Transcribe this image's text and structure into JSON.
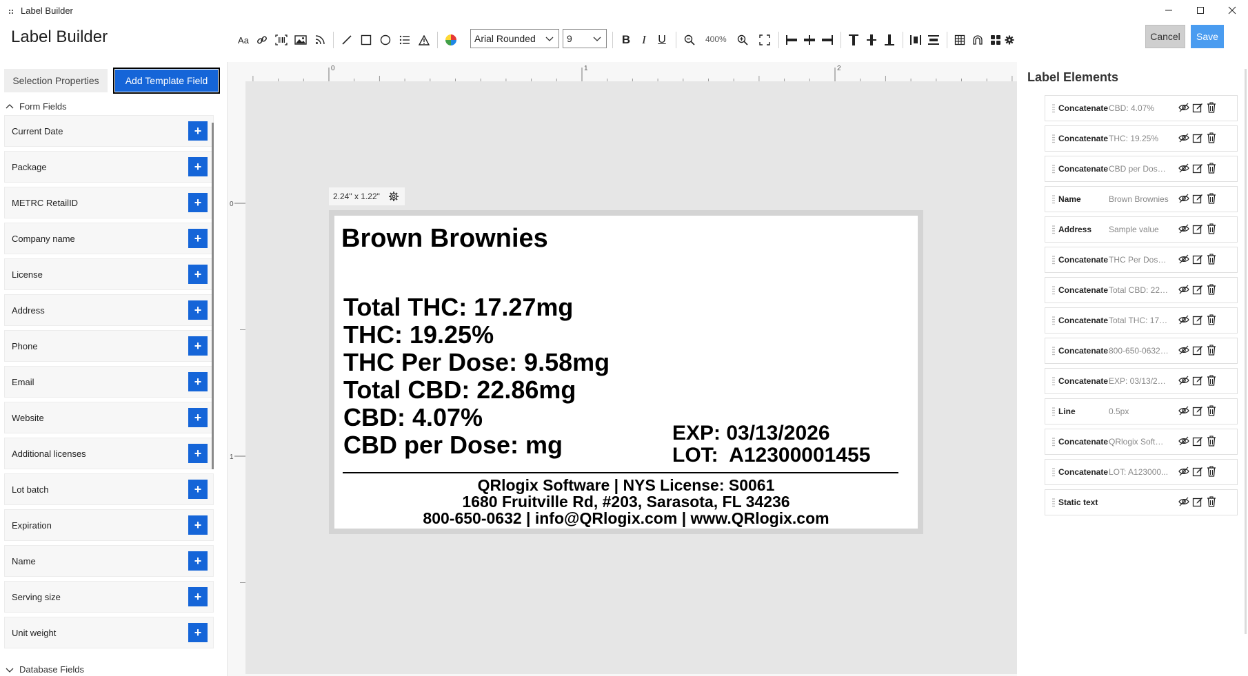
{
  "window": {
    "title": "Label Builder"
  },
  "header": {
    "app_title": "Label Builder",
    "font_family_value": "Arial Rounded",
    "font_size_value": "9",
    "zoom_level": "400%",
    "cancel_label": "Cancel",
    "save_label": "Save"
  },
  "left": {
    "tab_selection": "Selection Properties",
    "tab_add_template": "Add Template Field",
    "form_fields_heading": "Form Fields",
    "database_fields_heading": "Database Fields",
    "fields": [
      "Current Date",
      "Package",
      "METRC RetailID",
      "Company name",
      "License",
      "Address",
      "Phone",
      "Email",
      "Website",
      "Additional licenses",
      "Lot batch",
      "Expiration",
      "Name",
      "Serving size",
      "Unit weight"
    ],
    "add_symbol": "+"
  },
  "canvas": {
    "size_tag": "2.24\" x 1.22\"",
    "ruler_h": [
      "0",
      "1",
      "2"
    ],
    "ruler_v": [
      "0",
      "1"
    ],
    "label": {
      "title": "Brown Brownies",
      "lines": [
        "Total THC: 17.27mg",
        "THC: 19.25%",
        "THC Per Dose: 9.58mg",
        "Total CBD: 22.86mg",
        "CBD: 4.07%",
        "CBD per Dose: mg"
      ],
      "exp": "EXP: 03/13/2026",
      "lot": "LOT:  A12300001455",
      "footer": [
        "QRlogix Software | NYS License: S0061",
        "1680 Fruitville Rd, #203, Sarasota, FL 34236",
        "800-650-0632 | info@QRlogix.com | www.QRlogix.com"
      ]
    }
  },
  "right": {
    "title": "Label Elements",
    "elements": [
      {
        "type": "Concatenate",
        "value": "CBD: 4.07%"
      },
      {
        "type": "Concatenate",
        "value": "THC: 19.25%"
      },
      {
        "type": "Concatenate",
        "value": "CBD per Dose:..."
      },
      {
        "type": "Name",
        "value": "Brown Brownies"
      },
      {
        "type": "Address",
        "value": "Sample value"
      },
      {
        "type": "Concatenate",
        "value": "THC Per Dose:..."
      },
      {
        "type": "Concatenate",
        "value": "Total CBD: 22.8..."
      },
      {
        "type": "Concatenate",
        "value": "Total THC: 17.2..."
      },
      {
        "type": "Concatenate",
        "value": "800-650-0632 |..."
      },
      {
        "type": "Concatenate",
        "value": "EXP: 03/13/2026"
      },
      {
        "type": "Line",
        "value": "0.5px"
      },
      {
        "type": "Concatenate",
        "value": "QRlogix Softwa..."
      },
      {
        "type": "Concatenate",
        "value": "LOT:  A123000..."
      },
      {
        "type": "Static text",
        "value": ""
      }
    ]
  },
  "colors": {
    "accent": "#1565d8",
    "save": "#4a9cf0",
    "canvas_bg": "#e6e6e6"
  },
  "icons": [
    "text-icon",
    "link-icon",
    "barcode-icon",
    "image-icon",
    "rss-icon",
    "line-icon",
    "rectangle-icon",
    "circle-icon",
    "list-icon",
    "warning-icon",
    "color-wheel-icon",
    "bold-icon",
    "italic-icon",
    "underline-icon",
    "zoom-out-icon",
    "zoom-in-icon",
    "fit-icon",
    "align-left-icon",
    "align-center-h-icon",
    "align-right-icon",
    "align-top-icon",
    "align-middle-v-icon",
    "align-bottom-icon",
    "distribute-h-icon",
    "distribute-v-icon",
    "grid-icon",
    "magnet-icon",
    "apps-icon",
    "settings-icon"
  ]
}
